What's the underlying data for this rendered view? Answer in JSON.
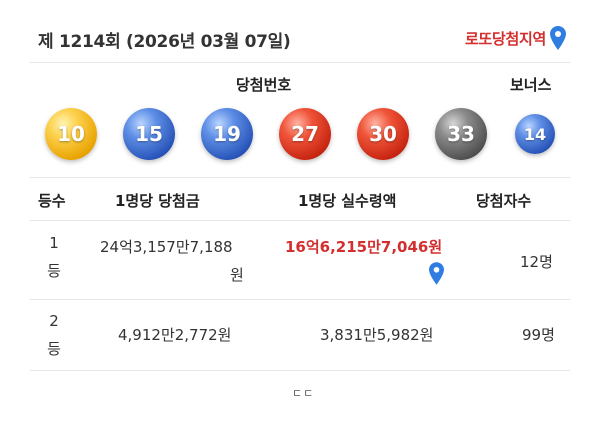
{
  "header": {
    "draw_title": "제 1214회 (2026년 03월 07일)",
    "region_link_label": "로또당첨지역",
    "region_icon": "location-pin-icon"
  },
  "numbers": {
    "winning_label": "당첨번호",
    "bonus_label": "보너스",
    "winning": [
      {
        "value": "10",
        "color": "#f5b800"
      },
      {
        "value": "15",
        "color": "#3a68cc"
      },
      {
        "value": "19",
        "color": "#3a68cc"
      },
      {
        "value": "27",
        "color": "#d93a22"
      },
      {
        "value": "30",
        "color": "#d93a22"
      },
      {
        "value": "33",
        "color": "#6a6a6a"
      }
    ],
    "bonus": {
      "value": "14",
      "color": "#3a68cc"
    }
  },
  "table": {
    "headers": {
      "rank": "등수",
      "prize_per_winner": "1명당 당첨금",
      "net_per_winner": "1명당 실수령액",
      "winner_count": "당첨자수"
    },
    "rows": [
      {
        "rank_top": "1",
        "rank_bottom": "등",
        "prize_line1": "24억3,157만7,188",
        "prize_line2": "원",
        "net": "16억6,215만7,046원",
        "winners": "12명"
      },
      {
        "rank_top": "2",
        "rank_bottom": "등",
        "prize_line1": "4,912만2,772원",
        "net": "3,831만5,982원",
        "winners": "99명"
      }
    ]
  },
  "footer": {
    "more_mark": "ㄷㄷ"
  },
  "colors": {
    "accent_red": "#d32f2f",
    "pin_blue": "#2f7de1"
  }
}
